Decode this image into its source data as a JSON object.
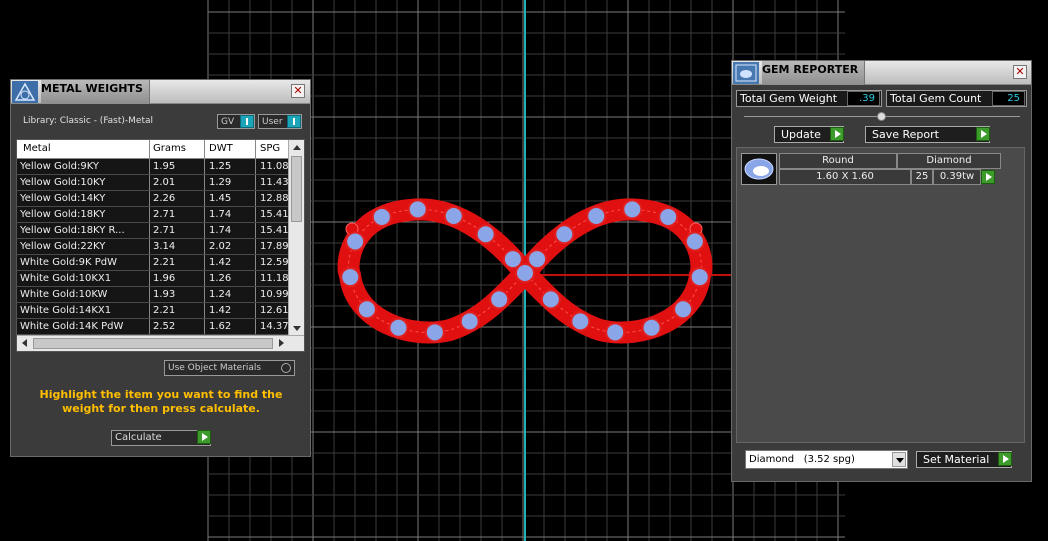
{
  "metal_weights": {
    "title": "METAL WEIGHTS",
    "library": "Library: Classic - (Fast)-Metal",
    "gv_label": "GV",
    "user_label": "User",
    "columns": [
      "Metal",
      "Grams",
      "DWT",
      "SPG"
    ],
    "rows": [
      [
        "Yellow Gold:9KY",
        "1.95",
        "1.25",
        "11.08"
      ],
      [
        "Yellow Gold:10KY",
        "2.01",
        "1.29",
        "11.43"
      ],
      [
        "Yellow Gold:14KY",
        "2.26",
        "1.45",
        "12.88"
      ],
      [
        "Yellow Gold:18KY",
        "2.71",
        "1.74",
        "15.41"
      ],
      [
        "Yellow Gold:18KY R...",
        "2.71",
        "1.74",
        "15.41"
      ],
      [
        "Yellow Gold:22KY",
        "3.14",
        "2.02",
        "17.89"
      ],
      [
        "White Gold:9K PdW",
        "2.21",
        "1.42",
        "12.59"
      ],
      [
        "White Gold:10KX1",
        "1.96",
        "1.26",
        "11.18"
      ],
      [
        "White Gold:10KW",
        "1.93",
        "1.24",
        "10.99"
      ],
      [
        "White Gold:14KX1",
        "2.21",
        "1.42",
        "12.61"
      ],
      [
        "White Gold:14K PdW",
        "2.52",
        "1.62",
        "14.37"
      ]
    ],
    "use_object_materials": "Use Object Materials",
    "hint": "Highlight the item you want to find the weight for then press calculate.",
    "calculate_label": "Calculate"
  },
  "gem_reporter": {
    "title": "GEM REPORTER",
    "total_weight_label": "Total Gem Weight",
    "total_weight_value": ".39",
    "total_count_label": "Total Gem Count",
    "total_count_value": "25",
    "update_label": "Update",
    "save_report_label": "Save Report",
    "gem": {
      "shape": "Round",
      "material": "Diamond",
      "size": "1.60 X 1.60",
      "count": "25",
      "weight": "0.39tw"
    },
    "material_select": "Diamond   (3.52 spg)",
    "set_material_label": "Set Material"
  },
  "colors": {
    "accent_teal": "#2ec8e0",
    "hint_yellow": "#ffbf00",
    "model_red": "#e01010",
    "gem_blue": "#8aa6e8"
  }
}
